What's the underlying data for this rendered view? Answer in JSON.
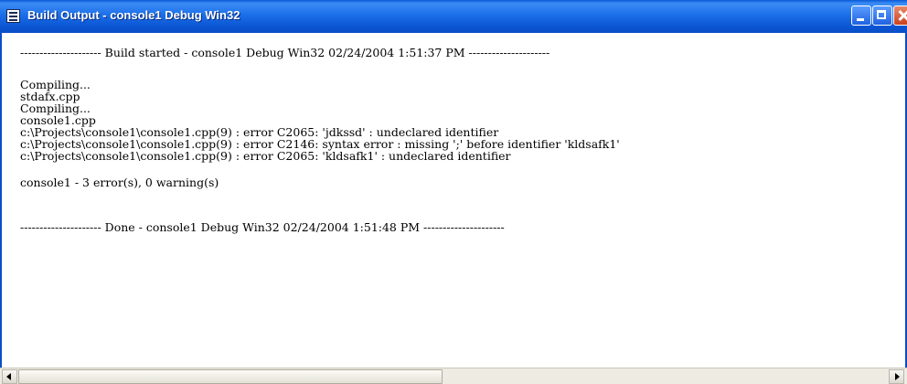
{
  "window": {
    "title": "Build Output - console1 Debug Win32",
    "icon": "build-output-icon"
  },
  "output": {
    "lines": [
      "--------------------- Build started - console1 Debug Win32 02/24/2004 1:51:37 PM ---------------------",
      "Compiling...",
      "stdafx.cpp",
      "Compiling...",
      "console1.cpp",
      "c:\\Projects\\console1\\console1.cpp(9) : error C2065: 'jdkssd' : undeclared identifier",
      "c:\\Projects\\console1\\console1.cpp(9) : error C2146: syntax error : missing ';' before identifier 'kldsafk1'",
      "c:\\Projects\\console1\\console1.cpp(9) : error C2065: 'kldsafk1' : undeclared identifier",
      "console1 - 3 error(s), 0 warning(s)",
      "--------------------- Done - console1 Debug Win32 02/24/2004 1:51:48 PM ---------------------"
    ]
  },
  "colors": {
    "title_bar": "#0a56d0",
    "background": "#ffffff",
    "text": "#000000",
    "close_button": "#c9421f"
  }
}
